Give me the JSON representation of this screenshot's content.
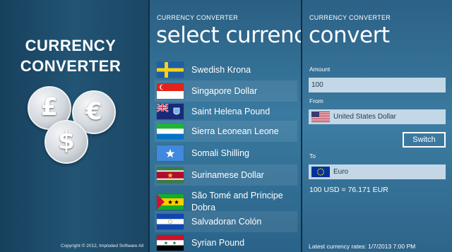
{
  "promo": {
    "title_line1": "CURRENCY",
    "title_line2": "CONVERTER",
    "coins": [
      "£",
      "€",
      "$"
    ],
    "copyright": "Copyright © 2012, Imploded Software All"
  },
  "select_screen": {
    "app_name": "CURRENCY CONVERTER",
    "title": "select currency",
    "currencies": [
      {
        "label": "Swedish Krona",
        "flag": "sweden-flag-icon"
      },
      {
        "label": "Singapore Dollar",
        "flag": "singapore-flag-icon"
      },
      {
        "label": "Saint Helena Pound",
        "flag": "saint-helena-flag-icon"
      },
      {
        "label": "Sierra Leonean Leone",
        "flag": "sierra-leone-flag-icon"
      },
      {
        "label": "Somali Shilling",
        "flag": "somalia-flag-icon"
      },
      {
        "label": "Surinamese Dollar",
        "flag": "suriname-flag-icon"
      },
      {
        "label": "São Tomé and Príncipe Dobra",
        "flag": "sao-tome-flag-icon"
      },
      {
        "label": "Salvadoran Colón",
        "flag": "el-salvador-flag-icon"
      },
      {
        "label": "Syrian Pound",
        "flag": "syria-flag-icon"
      }
    ]
  },
  "convert_screen": {
    "app_name": "CURRENCY CONVERTER",
    "title": "convert",
    "amount_label": "Amount",
    "amount_value": "100",
    "from_label": "From",
    "from_currency": "United States Dollar",
    "switch_label": "Switch",
    "to_label": "To",
    "to_currency": "Euro",
    "result": "100 USD = 76.171 EUR",
    "rates_footer": "Latest currency rates: 1/7/2013 7:00 PM"
  },
  "colors": {
    "background": "#1f4a68",
    "field_bg": "#c3d7e6",
    "field_text": "#1a3b52"
  }
}
